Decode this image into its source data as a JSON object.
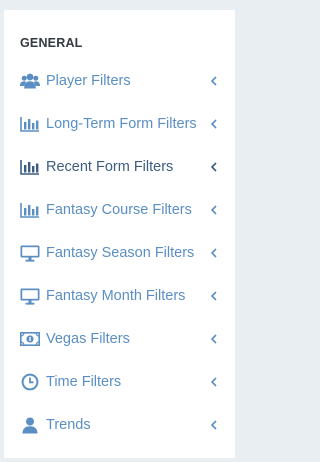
{
  "section": {
    "title": "GENERAL"
  },
  "colors": {
    "icon": "#5b8fc3",
    "label": "#5b8fc3",
    "active_label": "#3d5c82",
    "chevron": "#5b8fc3"
  },
  "menu": [
    {
      "label": "Player Filters",
      "icon": "users-icon"
    },
    {
      "label": "Long-Term Form Filters",
      "icon": "bar-chart-icon"
    },
    {
      "label": "Recent Form Filters",
      "icon": "bar-chart-icon",
      "active": true
    },
    {
      "label": "Fantasy Course Filters",
      "icon": "bar-chart-icon"
    },
    {
      "label": "Fantasy Season Filters",
      "icon": "desktop-icon"
    },
    {
      "label": "Fantasy Month Filters",
      "icon": "desktop-icon"
    },
    {
      "label": "Vegas Filters",
      "icon": "money-icon"
    },
    {
      "label": "Time Filters",
      "icon": "clock-icon"
    },
    {
      "label": "Trends",
      "icon": "user-icon"
    }
  ]
}
